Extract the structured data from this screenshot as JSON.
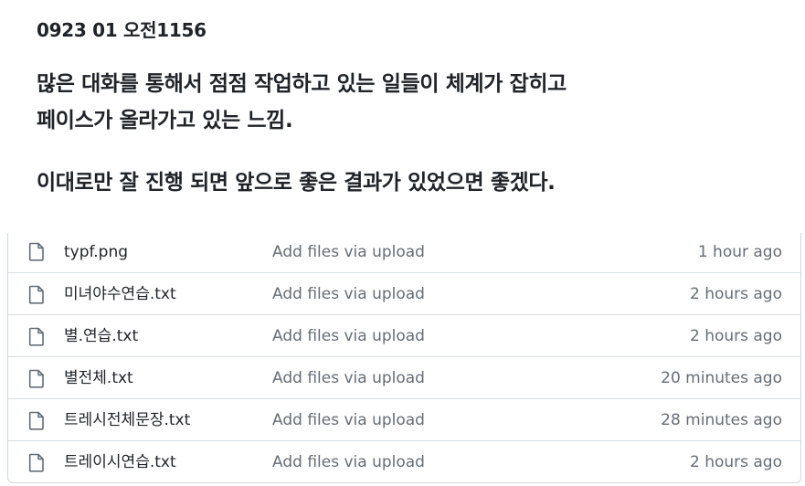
{
  "note": {
    "title": "0923 01 오전1156",
    "paragraphs": [
      [
        "많은 대화를 통해서 점점 작업하고 있는 일들이 체계가 잡히고",
        "페이스가 올라가고 있는 느낌."
      ],
      [
        "이대로만 잘 진행 되면 앞으로 좋은 결과가 있었으면 좋겠다."
      ]
    ]
  },
  "files": [
    {
      "icon": "file-icon",
      "name": "typf.png",
      "commit": "Add files via upload",
      "time": "1 hour ago"
    },
    {
      "icon": "file-icon",
      "name": "미녀야수연습.txt",
      "commit": "Add files via upload",
      "time": "2 hours ago"
    },
    {
      "icon": "file-icon",
      "name": "별.연습.txt",
      "commit": "Add files via upload",
      "time": "2 hours ago"
    },
    {
      "icon": "file-icon",
      "name": "별전체.txt",
      "commit": "Add files via upload",
      "time": "20 minutes ago"
    },
    {
      "icon": "file-icon",
      "name": "트레시전체문장.txt",
      "commit": "Add files via upload",
      "time": "28 minutes ago"
    },
    {
      "icon": "file-icon",
      "name": "트레이시연습.txt",
      "commit": "Add files via upload",
      "time": "2 hours ago"
    }
  ]
}
